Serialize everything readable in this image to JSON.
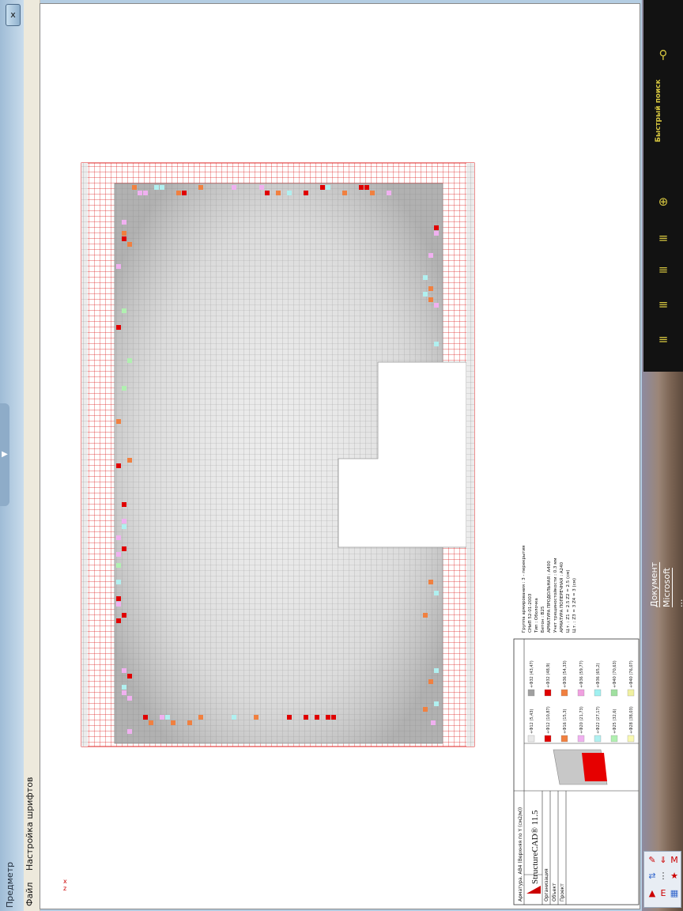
{
  "window": {
    "title": "Предметр",
    "close_label": "x"
  },
  "menu": {
    "items": [
      "Файл",
      "Настройка шрифтов"
    ]
  },
  "sidebar": {
    "search_label": "Быстрый поиск",
    "icons": [
      "search-icon",
      "zoom-in-icon",
      "list-icon",
      "list-icon",
      "list-icon",
      "list-icon",
      "list-icon"
    ]
  },
  "taskbar": {
    "doc_label": "Документ Microsoft ..."
  },
  "title_block": {
    "header": "Арматура. АВ4 (Верхняя по Y (см2/м))",
    "logo": "StructureCAD® 11.5",
    "row1": "Организация",
    "row2": "Объект",
    "row3": "Проект"
  },
  "legend": {
    "left_col": [
      "Ф12 (5,43)",
      "Ф12 (10,87)",
      "Ф16 (15,3)",
      "Ф20 (21,73)",
      "Ф22 (27,17)",
      "Ф25 (32,6)",
      "Ф28 (38,03)"
    ],
    "right_col": [
      "Ф32 (43,47)",
      "Ф32 (48,9)",
      "Ф36 (54,33)",
      "Ф36 (59,77)",
      "Ф36 (65,2)",
      "Ф40 (70,63)",
      "Ф40 (76,07)"
    ],
    "colors_left": [
      "#e8e8e8",
      "#e00000",
      "#f08040",
      "#f0b0f0",
      "#b0f0f0",
      "#b0f0b0",
      "#f8f8b0"
    ],
    "colors_right": [
      "#a0a0a0",
      "#e00000",
      "#f08040",
      "#f0a0e0",
      "#a0f0f0",
      "#a0e0a0",
      "#f0f0a0"
    ]
  },
  "notes": {
    "lines": [
      "Группа армирования : 3 - перекрытия",
      "СНиП 52-01-2003",
      "Тип : Оболочка",
      "Бетон : В25",
      "АРМАТУРА ПРОДОЛЬНАЯ : А400",
      "Учет трещиностойкости : 0.3 мм",
      "АРМАТУРА ПОПЕРЕЧНАЯ : А240",
      "Ц.т. : Z1 = 2.5  Z2 = 2.5 (см)",
      "Ц.т. : Z3 = 3  Z4 = 3 (см)"
    ]
  },
  "colors": {
    "red_mesh": "#dd1f1f",
    "grey_mesh": "#9a9a9a"
  }
}
